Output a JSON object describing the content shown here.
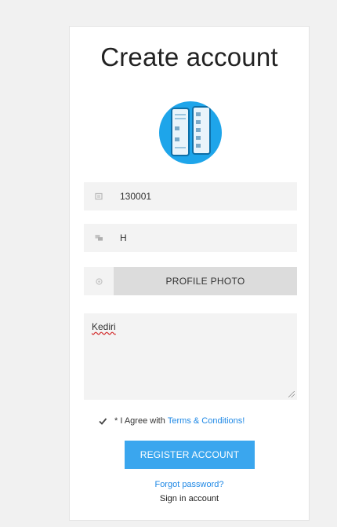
{
  "form": {
    "title": "Create account",
    "id_value": "130001",
    "name_value": "H",
    "photo_button_label": "PROFILE PHOTO",
    "address_value": "Kediri",
    "agree_prefix": "* I Agree with ",
    "agree_link": "Terms & Conditions!",
    "register_label": "REGISTER ACCOUNT",
    "forgot_label": "Forgot password?",
    "signin_label": "Sign in account"
  },
  "icons": {
    "id_field": "id-card-icon",
    "name_field": "chat-icon",
    "photo_field": "camera-icon",
    "agree_check": "checkmark-icon",
    "avatar": "phone-app-logo"
  },
  "colors": {
    "accent": "#3aa6ee",
    "link": "#1e88e5",
    "avatar_bg": "#1ea5ea"
  }
}
